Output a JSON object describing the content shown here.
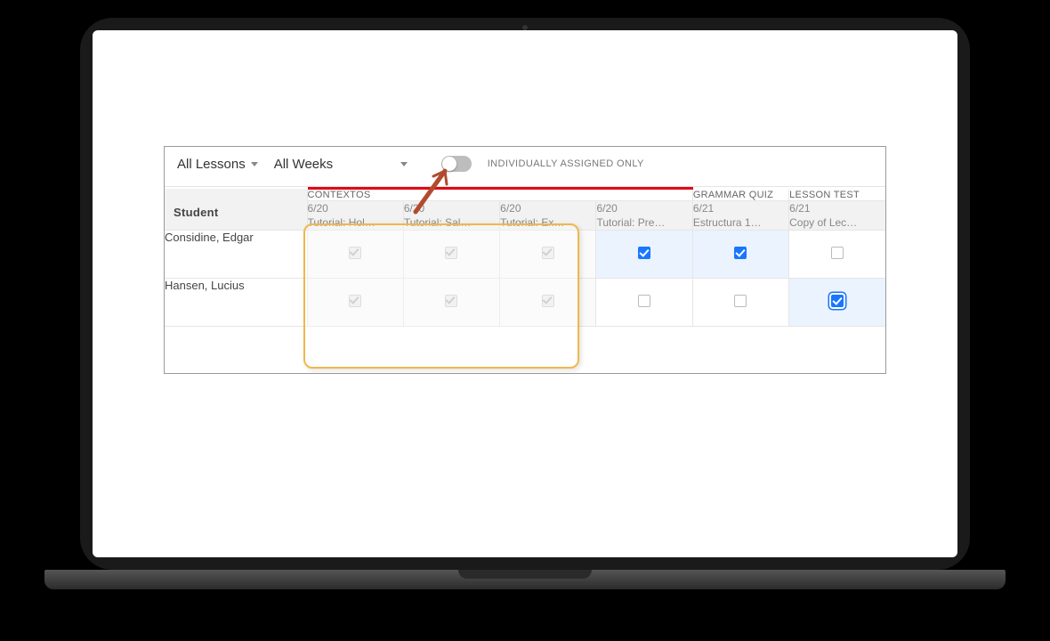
{
  "filters": {
    "lessons_label": "All Lessons",
    "weeks_label": "All Weeks",
    "toggle_label": "INDIVIDUALLY ASSIGNED ONLY",
    "toggle_on": false
  },
  "sections": {
    "student_header": "Student",
    "contextos": "CONTEXTOS",
    "grammar_quiz": "GRAMMAR QUIZ",
    "lesson_test": "LESSON TEST"
  },
  "columns": [
    {
      "date": "6/20",
      "title": "Tutorial: Hol…",
      "section": "contextos"
    },
    {
      "date": "6/20",
      "title": "Tutorial: Sal…",
      "section": "contextos"
    },
    {
      "date": "6/20",
      "title": "Tutorial: Ex…",
      "section": "contextos"
    },
    {
      "date": "6/20",
      "title": "Tutorial: Pre…",
      "section": "contextos"
    },
    {
      "date": "6/21",
      "title": "Estructura 1…",
      "section": "grammar_quiz"
    },
    {
      "date": "6/21",
      "title": "Copy of Lec…",
      "section": "lesson_test"
    }
  ],
  "rows": [
    {
      "name": "Considine, Edgar",
      "cells": [
        {
          "state": "disabled-checked"
        },
        {
          "state": "disabled-checked"
        },
        {
          "state": "disabled-checked"
        },
        {
          "state": "checked",
          "blue_bg": true
        },
        {
          "state": "checked",
          "blue_bg": true
        },
        {
          "state": "unchecked"
        }
      ]
    },
    {
      "name": "Hansen, Lucius",
      "cells": [
        {
          "state": "disabled-checked"
        },
        {
          "state": "disabled-checked"
        },
        {
          "state": "disabled-checked"
        },
        {
          "state": "unchecked"
        },
        {
          "state": "unchecked"
        },
        {
          "state": "checked",
          "blue_bg": true,
          "focus": true
        }
      ]
    }
  ]
}
